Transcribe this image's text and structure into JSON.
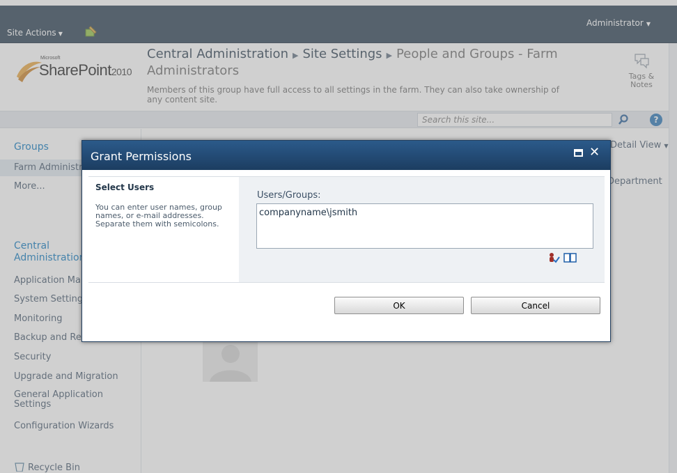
{
  "ribbon": {
    "site_actions": "Site Actions",
    "user_menu": "Administrator"
  },
  "logo": {
    "microsoft": "Microsoft",
    "sharepoint": "SharePoint",
    "year": "2010"
  },
  "breadcrumb": {
    "crumb1": "Central Administration",
    "crumb2": "Site Settings",
    "crumb3": "People and Groups - Farm Administrators"
  },
  "page_description": "Members of this group have full access to all settings in the farm. They can also take ownership of any content site.",
  "tags_notes": {
    "line1": "Tags &",
    "line2": "Notes"
  },
  "search": {
    "placeholder": "Search this site..."
  },
  "left_nav": {
    "groups_heading": "Groups",
    "group_item": "Farm Administrators",
    "more": "More...",
    "central_admin_line1": "Central",
    "central_admin_line2": "Administration",
    "items": [
      "Application Management",
      "System Settings",
      "Monitoring",
      "Backup and Restore",
      "Security",
      "Upgrade and Migration",
      "General Application Settings",
      "Configuration Wizards"
    ],
    "recycle_bin": "Recycle Bin"
  },
  "content": {
    "view_button": "Detail View",
    "department_column": "Department"
  },
  "dialog": {
    "title": "Grant Permissions",
    "section_heading": "Select Users",
    "section_description": "You can enter user names, group names, or e-mail addresses. Separate them with semicolons.",
    "users_label": "Users/Groups:",
    "users_value": "companyname\\jsmith",
    "ok_label": "OK",
    "cancel_label": "Cancel"
  },
  "colors": {
    "ribbon": "#21374c",
    "dialog_title": "#1c3d61",
    "link_blue": "#0072bc"
  }
}
